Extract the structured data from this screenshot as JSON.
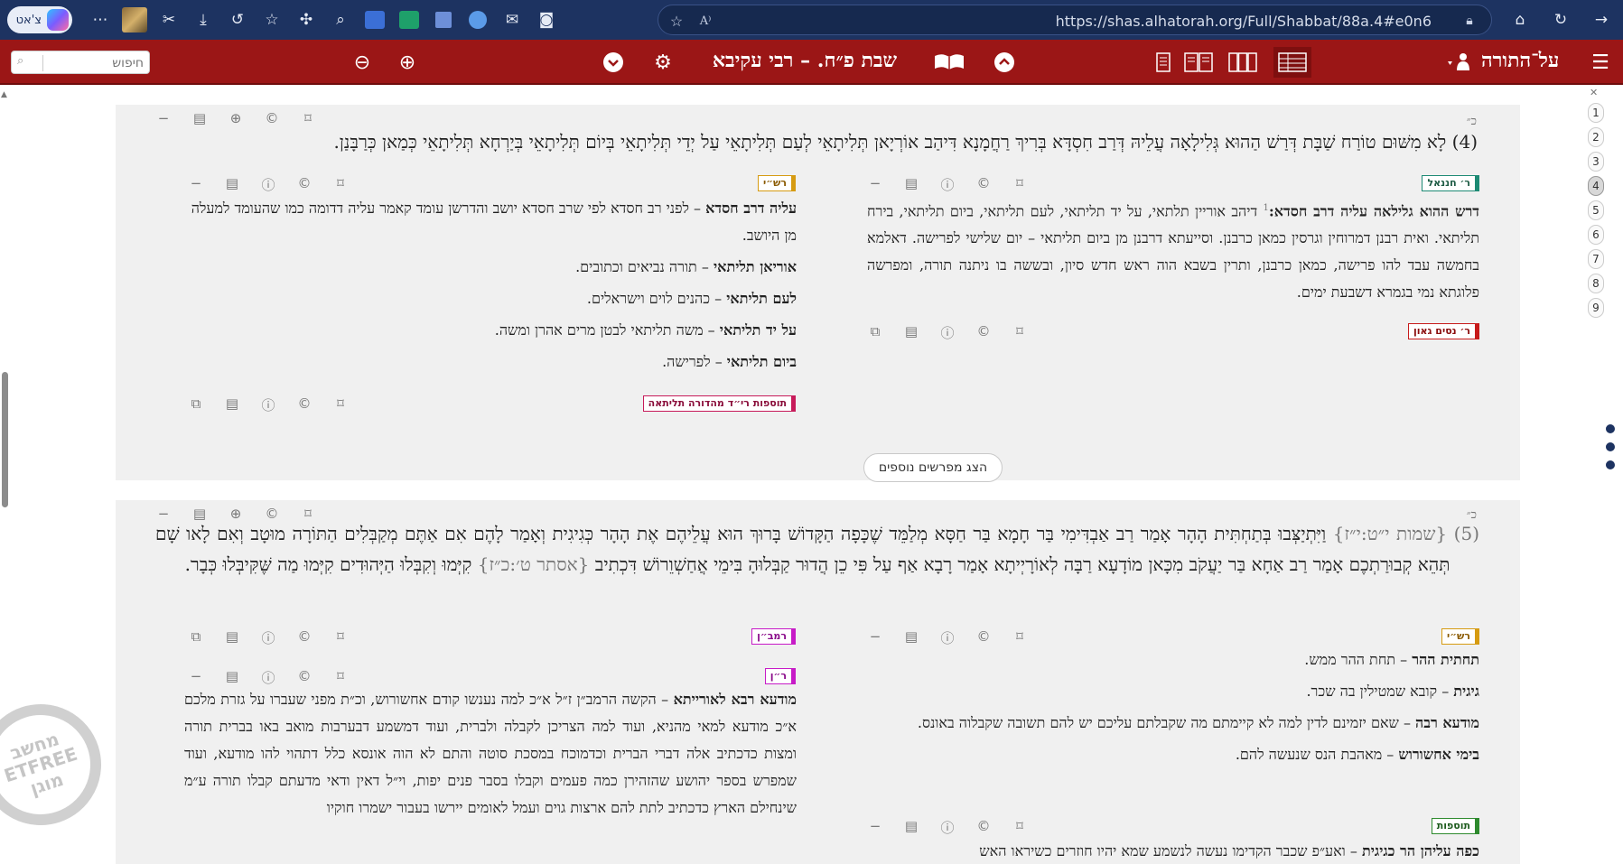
{
  "browser": {
    "chat_label": "צ'אט",
    "url": "https://shas.alhatorah.org/Full/Shabbat/88a.4#e0n6",
    "icons": [
      "copilot-icon",
      "more-icon",
      "extension-avatar-icon",
      "scissor-icon",
      "download-icon",
      "history-icon",
      "favorites-icon",
      "puzzle-icon",
      "zoom-icon",
      "translate-icon",
      "screen-icon",
      "save-icon",
      "upload-icon",
      "mail-icon",
      "camera-icon",
      "star-icon",
      "read-aloud-icon",
      "lock-icon",
      "home-icon",
      "refresh-icon",
      "forward-icon"
    ]
  },
  "site": {
    "search_placeholder": "חיפוש",
    "location_title": "שבת פ״ח. – רבי עקיבא",
    "logo": "על־התורה"
  },
  "page_nav": [
    "1",
    "2",
    "3",
    "4",
    "5",
    "6",
    "7",
    "8",
    "9"
  ],
  "page_nav_active": "4",
  "section1": {
    "verse_marker": "כ״",
    "main_text": "(4) לָא מִשּׁוּם טוֹרַח שַׁבָּת דְּרַשׁ הַהוּא גְּלִילָאָה עֲלֵיהּ דְּרַב חִסְדָּא בְּרִיךְ רַחֲמָנָא דִּיהַב אוֹרְיָאן תְּלִיתָאֵי לְעַם תְּלִיתָאֵי עַל יְדֵי תְּלִיתָאֵי בְּיוֹם תְּלִיתָאֵי בְּיַרְחָא תְּלִיתָאֵי כְּמַאן כְּרַבָּנַן.",
    "rhananel_tag": "ר׳ חננאל",
    "rhananel_headword": "דרש ההוא גלילאה עליה דרב חסדא:",
    "rhananel_note": "1",
    "rhananel_text": "דיהב אוריין תלתאי, על יד תליתאי, לעם תליתאי, ביום תליתאי, בירח תליתאי. ואית רבנן דמרוחין וגרסין כמאן כרבנן. וסייעתא דרבנן מן ביום תליתאי – יום שלישי לפרישה. דאלמא בחמשה עבד להו פרישה, כמאן כרבנן, ותרין בשבא הוה ראש חדש סיון, ובששה בו ניתנה תורה, ומפרשה פלוגתא נמי בגמרא דשבעת ימים.",
    "rhananel_bold_fragment": "כמאן כרבנן",
    "nissim_tag": "ר׳ נסים גאון",
    "rashi_tag": "רש״י",
    "rashi_entries": [
      {
        "head": "עליה דרב חסדא",
        "text": " – לפני רב חסדא לפי שרב חסדא יושב והדרשן עומד קאמר עליה דדומה כמו שהעומד למעלה מן היושב."
      },
      {
        "head": "אוריאן תליתאי",
        "text": " – תורה נביאים וכתובים."
      },
      {
        "head": "לעם תליתאי",
        "text": " – כהנים לוים וישראלים."
      },
      {
        "head": "על יד תליתאי",
        "text": " – משה תליתאי לבטן מרים אהרן ומשה."
      },
      {
        "head": "ביום תליתאי",
        "text": " – לפרישה."
      }
    ],
    "tosafot_rid_tag": "תוספות רי״ד מהדורה תליתאה",
    "show_more_label": "הצג מפרשים נוספים"
  },
  "section2": {
    "verse_marker": "כ״",
    "main_text_num": "(5)",
    "main_text_ref1": "{שמות י״ט:י״ז}",
    "main_text_part1": "וַיִּתְיַצְּבוּ בְּתַחְתִּית הָהָר אָמַר רַב אַבְדִּימִי בַּר חָמָא בַּר חַסָּא מְלַמֵּד שֶׁכָּפָה הַקָּדוֹשׁ בָּרוּךְ הוּא עֲלֵיהֶם אֶת הָהָר כְּגִיגִית וְאָמַר לָהֶם אִם אַתֶּם מְקַבְּלִים הַתּוֹרָה מוּטָב וְאִם לָאו שָׁם תְּהֵא קְבוּרַתְכֶם אָמַר רַב אַחָא בַּר יַעֲקֹב מִכָּאן מוֹדָעָא רַבָּה לְאוֹרָיְיתָא אָמַר רָבָא אַף עַל פִּי כֵן הֲדוּר קַבְּלוּהָ בִּימֵי אֲחַשְׁוֵרוֹשׁ דִּכְתִיב",
    "main_text_ref2": "{אסתר ט׳:כ״ז}",
    "main_text_part2": "קִיְּמוּ וְקִבְּלוּ הַיְּהוּדִים קִיְּמוּ מַה שֶּׁקִּיבְּלוּ כְּבָר.",
    "rashi_tag": "רש״י",
    "rashi_entries": [
      {
        "head": "תחתית ההר",
        "text": " – תחת ההר ממש."
      },
      {
        "head": "גיגית",
        "text": " – קובא שמטילין בה שכר."
      },
      {
        "head": "מודעא רבה",
        "text": " – שאם יזמינם לדין למה לא קיימתם מה שקבלתם עליכם יש להם תשובה שקבלוה באונס."
      },
      {
        "head": "בימי אחשורוש",
        "text": " – מאהבת הנס שנעשה להם."
      }
    ],
    "tosafot_tag": "תוספות",
    "tosafot_head": "כפה עליהן הר כגיגית",
    "tosafot_text": " – ואע״פ שכבר הקדימו נעשה לנשמע שמא יהיו חוזרים כשיראו האש",
    "ramban_tag": "רמב״ן",
    "ran_tag": "ר״ן",
    "ran_head": "מודעא רבא לאורייתא",
    "ran_text": " – הקשה הרמב״ן ז״ל א״כ למה נענשו קודם אחשורוש, וכ״ת מפני שעברו על גזרת מלכם א״כ מודעא למאי מהניא, ועוד למה הצריכן לקבלה ולברית, ועוד דמשמע דבערבות מואב באו בברית תורה ומצות כדכתיב אלה דברי הברית וכדמוכח במסכת סוטה והתם לא הוה אונסא כלל דתהוי להו מודעא, ועוד שמפרש בספר יהושע שהזהירן כמה פעמים וקבלו בסבר פנים יפות, וי״ל דאין ודאי מדעתם קבלו תורה ע״מ שינחילם הארץ כדכתיב לתת להם ארצות גוים ועמל לאומים יירשו בעבור ישמרו חוקיו"
  },
  "watermark": {
    "line1": "מחשב",
    "line2": "ETFREE",
    "line3": "מוגן"
  }
}
